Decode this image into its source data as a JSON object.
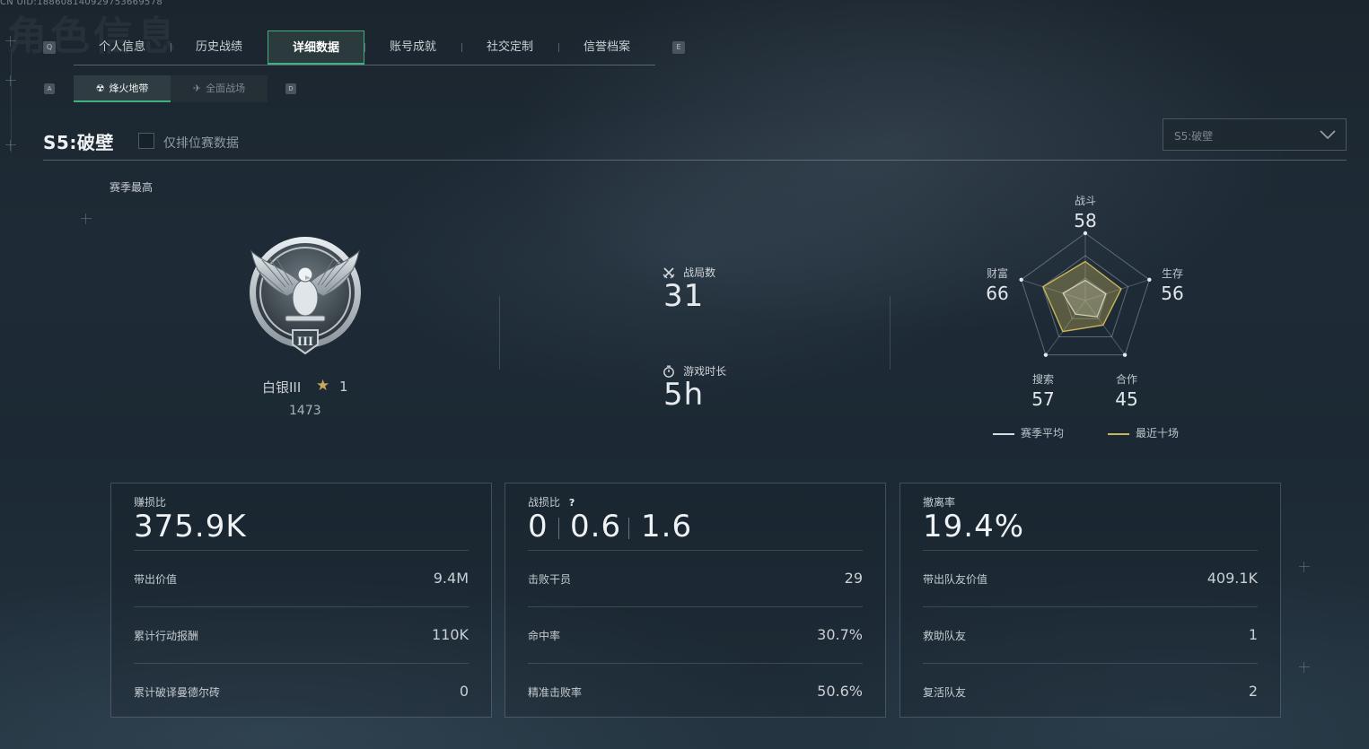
{
  "uid": "CN UID:1886081409297536695​78",
  "bg_title": "角色信息",
  "keys": {
    "prev_tab": "Q",
    "next_tab": "E",
    "prev_sub": "A",
    "next_sub": "D"
  },
  "tabs": [
    {
      "label": "个人信息",
      "active": false
    },
    {
      "label": "历史战绩",
      "active": false
    },
    {
      "label": "详细数据",
      "active": true
    },
    {
      "label": "账号成就",
      "active": false
    },
    {
      "label": "社交定制",
      "active": false
    },
    {
      "label": "信誉档案",
      "active": false
    }
  ],
  "subtabs": [
    {
      "label": "烽火地带",
      "icon": "hazard-zone-icon",
      "active": true
    },
    {
      "label": "全面战场",
      "icon": "battlefield-icon",
      "active": false
    }
  ],
  "season": {
    "title": "S5:破壁",
    "ranked_only_label": "仅排位赛数据",
    "ranked_only_checked": false,
    "select_value": "S5:破壁"
  },
  "best": {
    "label": "赛季最高",
    "rank_name": "白银III",
    "rank_tier_numeral": "III",
    "stars": "1",
    "score": "1473"
  },
  "middle": {
    "matches_label": "战局数",
    "matches_value": "31",
    "playtime_label": "游戏时长",
    "playtime_value": "5h"
  },
  "radar": {
    "axes": [
      {
        "label": "战斗",
        "value": "58"
      },
      {
        "label": "生存",
        "value": "56"
      },
      {
        "label": "合作",
        "value": "45"
      },
      {
        "label": "搜索",
        "value": "57"
      },
      {
        "label": "财富",
        "value": "66"
      }
    ],
    "season_avg_pct": [
      0.3,
      0.32,
      0.3,
      0.25,
      0.35
    ],
    "recent_pct": [
      0.58,
      0.56,
      0.45,
      0.57,
      0.66
    ],
    "legend": {
      "season_avg": "赛季平均",
      "recent_ten": "最近十场"
    },
    "colors": {
      "recent": "#c9b45a",
      "season_avg": "#d8dde0"
    }
  },
  "panels": {
    "profit": {
      "title": "赚损比",
      "value": "375.9K",
      "rows": [
        {
          "label": "带出价值",
          "value": "9.4M"
        },
        {
          "label": "累计行动报酬",
          "value": "110K"
        },
        {
          "label": "累计破译曼德尔砖",
          "value": "0"
        }
      ]
    },
    "kd": {
      "title": "战损比",
      "values": [
        "0",
        "0.6",
        "1.6"
      ],
      "rows": [
        {
          "label": "击败干员",
          "value": "29"
        },
        {
          "label": "命中率",
          "value": "30.7%"
        },
        {
          "label": "精准击败率",
          "value": "50.6%"
        }
      ]
    },
    "extract": {
      "title": "撤离率",
      "value": "19.4%",
      "rows": [
        {
          "label": "带出队友价值",
          "value": "409.1K"
        },
        {
          "label": "救助队友",
          "value": "1"
        },
        {
          "label": "复活队友",
          "value": "2"
        }
      ]
    }
  },
  "colors": {
    "accent": "#3fb07e",
    "gold": "#c9a85a"
  }
}
